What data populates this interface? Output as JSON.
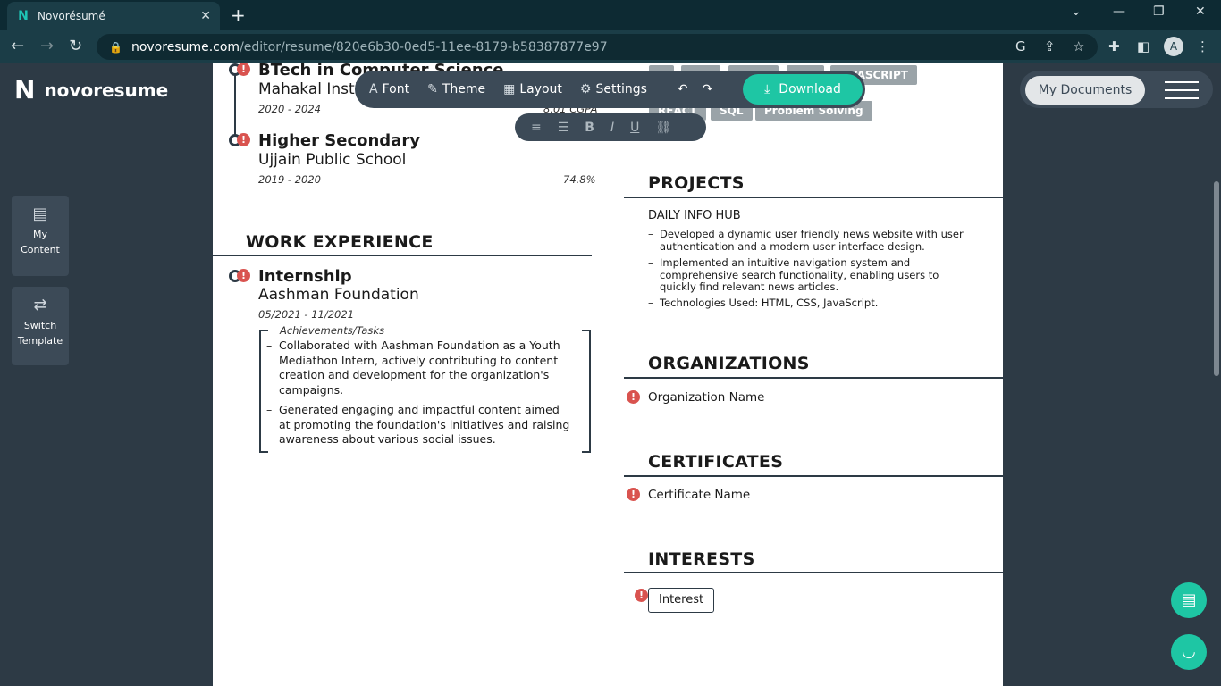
{
  "browser": {
    "tab_title": "Novorésumé",
    "url_domain": "novoresume.com",
    "url_path": "/editor/resume/820e6b30-0ed5-11ee-8179-b58387877e97",
    "avatar_letter": "A"
  },
  "app": {
    "logo": "novoresume",
    "sidebar": [
      {
        "label1": "My",
        "label2": "Content"
      },
      {
        "label1": "Switch",
        "label2": "Template"
      }
    ],
    "my_documents": "My Documents"
  },
  "toolbar": {
    "font": "Font",
    "theme": "Theme",
    "layout": "Layout",
    "settings": "Settings",
    "download": "Download"
  },
  "resume": {
    "education": [
      {
        "degree": "BTech in Computer Science",
        "school": "Mahakal Insti",
        "dates": "2020 - 2024",
        "grade": "8.01 CGPA"
      },
      {
        "degree": "Higher Secondary",
        "school": "Ujjain Public School",
        "dates": "2019 - 2020",
        "grade": "74.8%"
      }
    ],
    "skills_row1_partial": "VASCRIPT",
    "skills_row2": [
      "REACT",
      "SQL",
      "Problem Solving"
    ],
    "work_title": "WORK EXPERIENCE",
    "work": {
      "title": "Internship",
      "company": "Aashman Foundation",
      "dates": "05/2021 - 11/2021",
      "tasks_label": "Achievements/Tasks",
      "bullets": [
        "Collaborated with Aashman Foundation as a Youth Mediathon Intern, actively contributing to content creation and development for the organization's campaigns.",
        "Generated engaging and impactful content aimed at promoting the foundation's initiatives and raising awareness about various social issues."
      ]
    },
    "projects_title": "PROJECTS",
    "project": {
      "name": "DAILY INFO HUB",
      "bullets": [
        "Developed a dynamic user friendly news website with user authentication and a modern user interface design.",
        "Implemented an intuitive navigation system and comprehensive search functionality, enabling users to quickly find relevant news articles.",
        "Technologies Used: HTML, CSS, JavaScript."
      ]
    },
    "organizations_title": "ORGANIZATIONS",
    "organization_placeholder": "Organization Name",
    "certificates_title": "CERTIFICATES",
    "certificate_placeholder": "Certificate Name",
    "interests_title": "INTERESTS",
    "interest_placeholder": "Interest"
  }
}
